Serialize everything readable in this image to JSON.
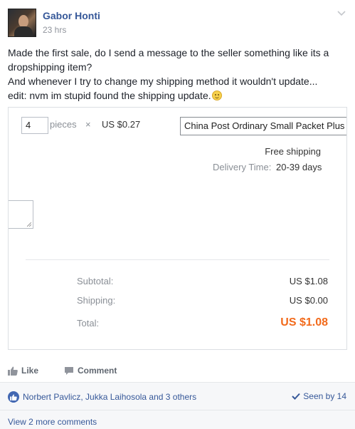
{
  "post": {
    "author": "Gabor Honti",
    "time": "23 hrs",
    "text_lines": [
      "Made the first sale, do I send a message to the seller something like its a",
      "dropshipping item?",
      "And whenever I try to change my shipping method it wouldn't update...",
      "edit: nvm im stupid found the shipping update."
    ]
  },
  "screenshot": {
    "quantity": "4",
    "pieces_label": "pieces",
    "times_sign": "×",
    "unit_price": "US $0.27",
    "shipping_method": "China Post Ordinary Small Packet Plus",
    "free_shipping": "Free shipping",
    "delivery_label": "Delivery Time:",
    "delivery_value": "20-39 days",
    "subtotal_label": "Subtotal:",
    "subtotal_value": "US $1.08",
    "shipping_label": "Shipping:",
    "shipping_value": "US $0.00",
    "total_label": "Total:",
    "total_value": "US $1.08"
  },
  "actions": {
    "like": "Like",
    "comment": "Comment"
  },
  "reactions": {
    "likers": "Norbert Pavlicz, Jukka Laihosola and 3 others",
    "seen": "Seen by 14"
  },
  "comments": {
    "more": "View 2 more comments"
  },
  "colors": {
    "link": "#365899",
    "total": "#f26a1b",
    "like_badge": "#4267b2"
  },
  "icons": [
    "chevron-down-icon",
    "smiley-icon",
    "thumbs-up-icon",
    "comment-icon",
    "like-badge-icon",
    "checkmark-icon"
  ]
}
